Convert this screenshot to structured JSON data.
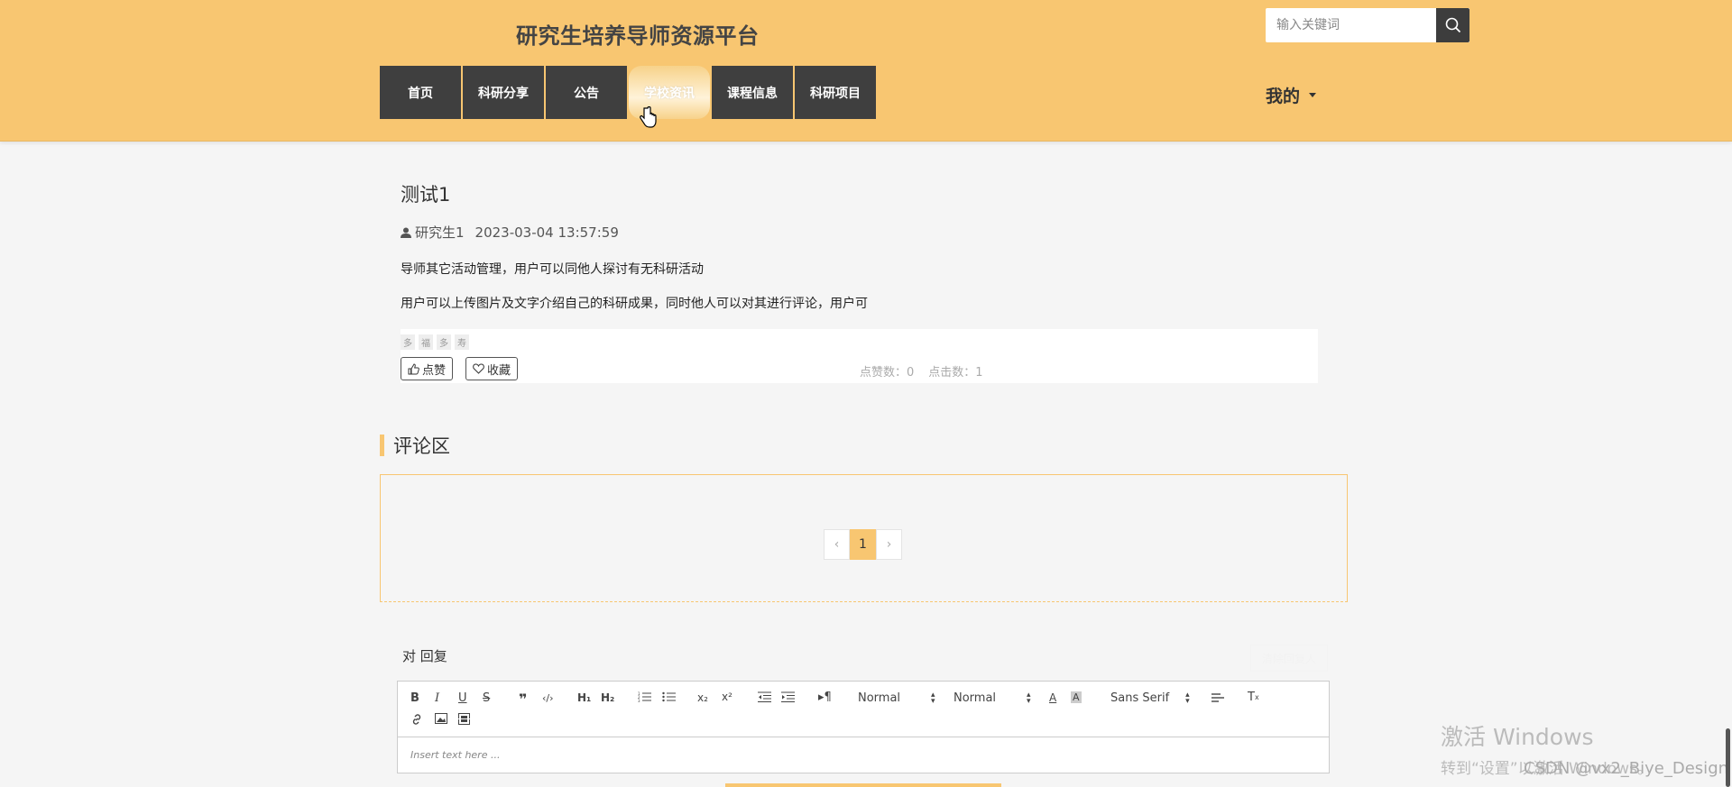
{
  "header": {
    "site_title": "研究生培养导师资源平台",
    "search_placeholder": "输入关键词",
    "nav": [
      "首页",
      "科研分享",
      "公告",
      "学校资讯",
      "课程信息",
      "科研项目"
    ],
    "active_nav": "学校资讯",
    "mine_label": "我的"
  },
  "post": {
    "title": "测试1",
    "author": "研究生1",
    "time": "2023-03-04 13:57:59",
    "paragraphs": [
      "导师其它活动管理，用户可以同他人探讨有无科研活动",
      "用户可以上传图片及文字介绍自己的科研成果，同时他人可以对其进行评论，用户可"
    ],
    "tags": [
      "多",
      "福",
      "多",
      "寿"
    ],
    "like_label": "点赞",
    "favorite_label": "收藏",
    "likes_text": "点赞数：0",
    "clicks_text": "点击数：1"
  },
  "comments": {
    "title": "评论区",
    "pager": {
      "prev": "‹",
      "current": "1",
      "next": "›"
    }
  },
  "reply": {
    "label": "对 回复",
    "clear_label": "清除回复人",
    "toolbar": {
      "header_select": "Normal",
      "size_select": "Normal",
      "font_select": "Sans Serif"
    },
    "placeholder": "Insert text here ..."
  },
  "os": {
    "activate_title": "激活 Windows",
    "activate_sub": "转到“设置”以激活 Windows。",
    "watermark": "CSDN @vx2_Biye_Design"
  }
}
